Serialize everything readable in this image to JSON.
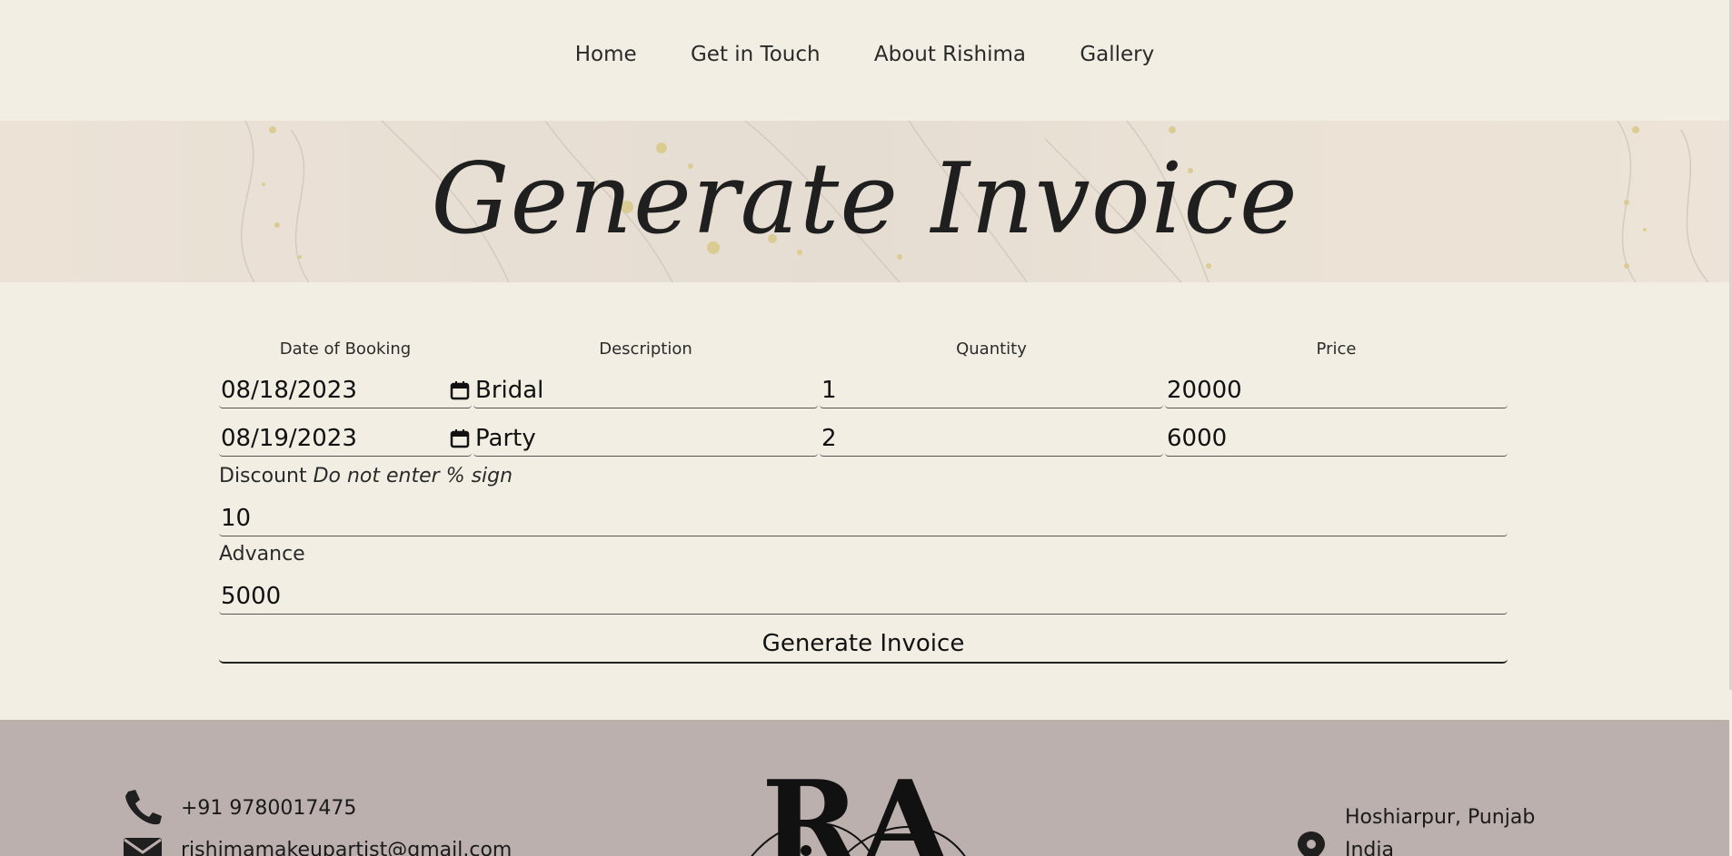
{
  "nav": {
    "items": [
      {
        "label": "Home"
      },
      {
        "label": "Get in Touch"
      },
      {
        "label": "About Rishima"
      },
      {
        "label": "Gallery"
      }
    ]
  },
  "hero": {
    "title": "Generate Invoice"
  },
  "form": {
    "columns": [
      "Date of Booking",
      "Description",
      "Quantity",
      "Price"
    ],
    "rows": [
      {
        "date": "08/18/2023",
        "description": "Bridal",
        "quantity": "1",
        "price": "20000"
      },
      {
        "date": "08/19/2023",
        "description": "Party",
        "quantity": "2",
        "price": "6000"
      }
    ],
    "discount_label": "Discount",
    "discount_hint": "Do not enter % sign",
    "discount_value": "10",
    "advance_label": "Advance",
    "advance_value": "5000",
    "submit_label": "Generate Invoice"
  },
  "footer": {
    "phone": "+91 9780017475",
    "email": "rishimamakeupartist@gmail.com",
    "location_line1": "Hoshiarpur, Punjab",
    "location_line2": "India",
    "logo_text": "RA"
  },
  "icons": {
    "phone": "phone-icon",
    "email": "envelope-icon",
    "location": "map-pin-icon",
    "calendar": "calendar-icon"
  },
  "colors": {
    "page_bg": "#f2eee3",
    "footer_bg": "#bbb0ae",
    "text": "#222222"
  }
}
